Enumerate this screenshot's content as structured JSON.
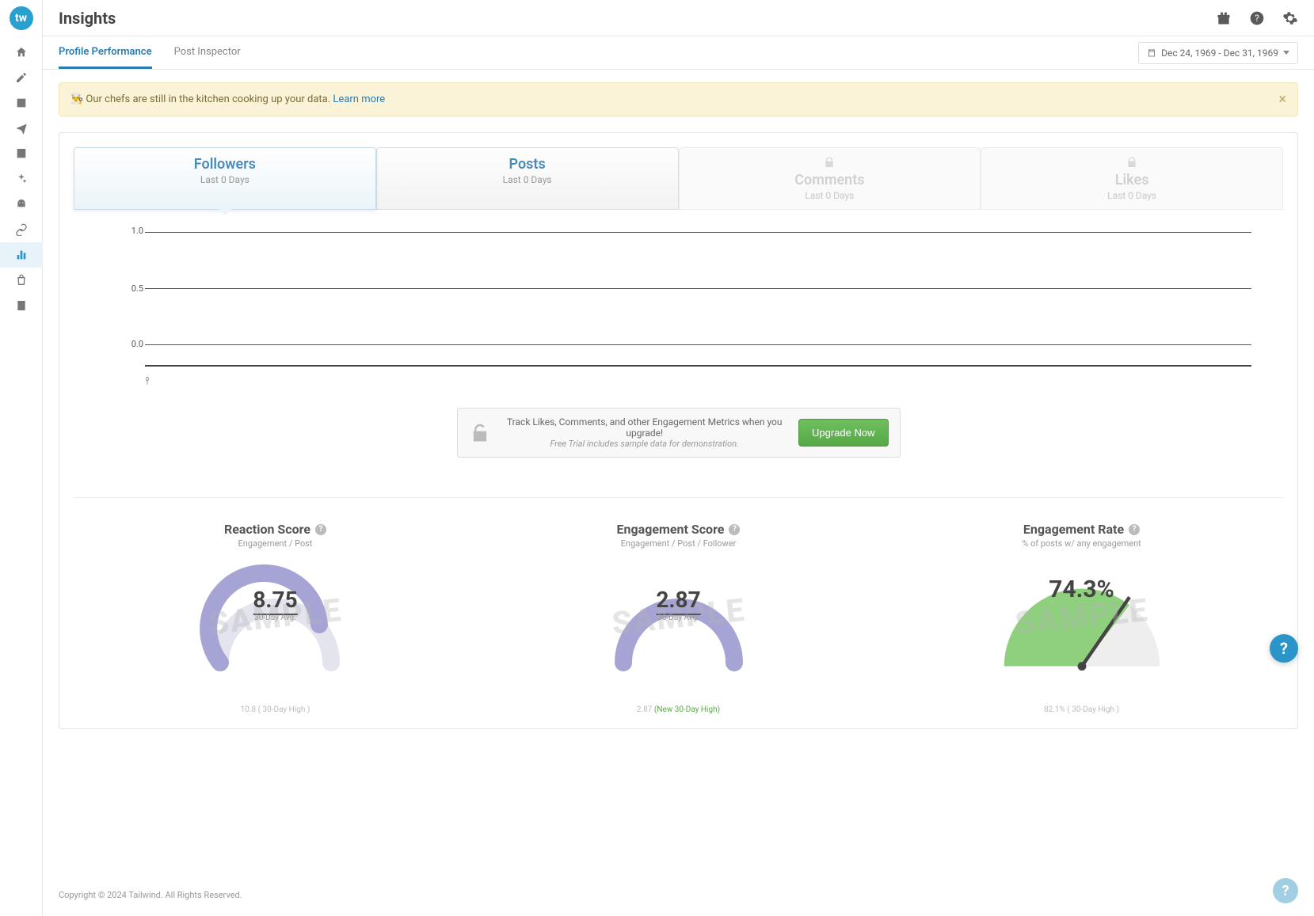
{
  "page_title": "Insights",
  "tabs": {
    "profile_performance": "Profile Performance",
    "post_inspector": "Post Inspector"
  },
  "date_range": "Dec 24, 1969 - Dec 31, 1969",
  "banner": {
    "emoji": "👨‍🍳",
    "text": "Our chefs are still in the kitchen cooking up your data.",
    "link": "Learn more"
  },
  "metric_tabs": [
    {
      "title": "Followers",
      "sub": "Last 0 Days",
      "active": true,
      "locked": false
    },
    {
      "title": "Posts",
      "sub": "Last 0 Days",
      "active": false,
      "locked": false
    },
    {
      "title": "Comments",
      "sub": "Last 0 Days",
      "active": false,
      "locked": true
    },
    {
      "title": "Likes",
      "sub": "Last 0 Days",
      "active": false,
      "locked": true
    }
  ],
  "upgrade": {
    "headline": "Track Likes, Comments, and other Engagement Metrics when you upgrade!",
    "sub": "Free Trial includes sample data for demonstration.",
    "button": "Upgrade Now"
  },
  "gauges": {
    "reaction": {
      "title": "Reaction Score",
      "sub": "Engagement / Post",
      "value": "8.75",
      "avg_label": "30-Day Avg.",
      "high": "10.8 ( 30-Day High )"
    },
    "engagement_score": {
      "title": "Engagement Score",
      "sub": "Engagement / Post / Follower",
      "value": "2.87",
      "avg_label": "30-Day Avg.",
      "high_prefix": "2.87",
      "high_green": "(New 30-Day High)"
    },
    "engagement_rate": {
      "title": "Engagement Rate",
      "sub": "% of posts w/ any engagement",
      "value": "74.3%",
      "high": "82.1% ( 30-Day High )"
    }
  },
  "watermark": "SAMPLE",
  "footer": "Copyright © 2024 Tailwind. All Rights Reserved.",
  "chart_data": {
    "type": "line",
    "title": "Followers — Last 0 Days",
    "xlabel": "",
    "ylabel": "",
    "ylim": [
      0.0,
      1.0
    ],
    "y_ticks": [
      "1.0",
      "0.5",
      "0.0"
    ],
    "x": [],
    "values": [],
    "note": "empty trend chart (no data loaded)"
  }
}
